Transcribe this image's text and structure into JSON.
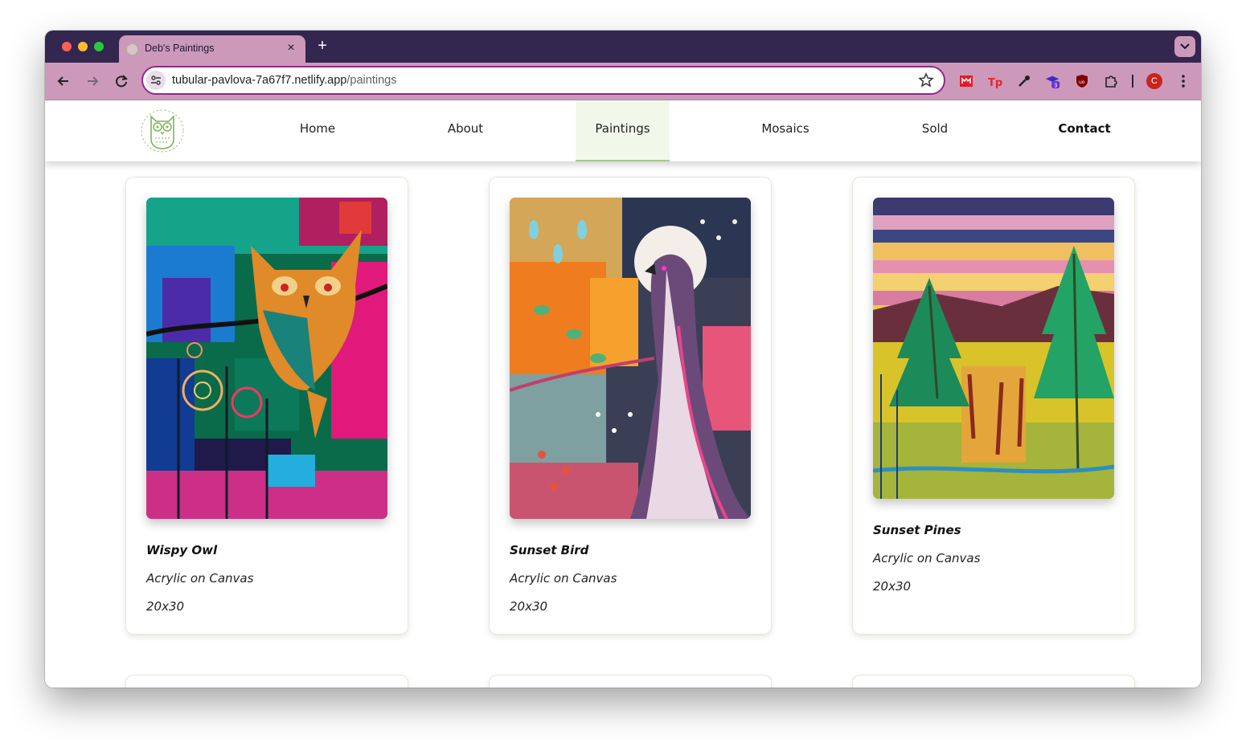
{
  "browser": {
    "tab_title": "Deb's Paintings",
    "url_host": "tubular-pavlova-7a67f7.netlify.app",
    "url_path": "/paintings",
    "extension_badge": "3",
    "profile_initial": "C",
    "colors": {
      "frame": "#33264f",
      "toolbar": "#cc99bb",
      "omnibox_border": "#8e2a8a"
    }
  },
  "site": {
    "nav": [
      "Home",
      "About",
      "Paintings",
      "Mosaics",
      "Sold",
      "Contact"
    ],
    "active_nav": "Paintings",
    "accent": "#a4c98a"
  },
  "paintings": [
    {
      "title": "Wispy Owl",
      "medium": "Acrylic on Canvas",
      "size": "20x30"
    },
    {
      "title": "Sunset Bird",
      "medium": "Acrylic on Canvas",
      "size": "20x30"
    },
    {
      "title": "Sunset Pines",
      "medium": "Acrylic on Canvas",
      "size": "20x30"
    }
  ]
}
